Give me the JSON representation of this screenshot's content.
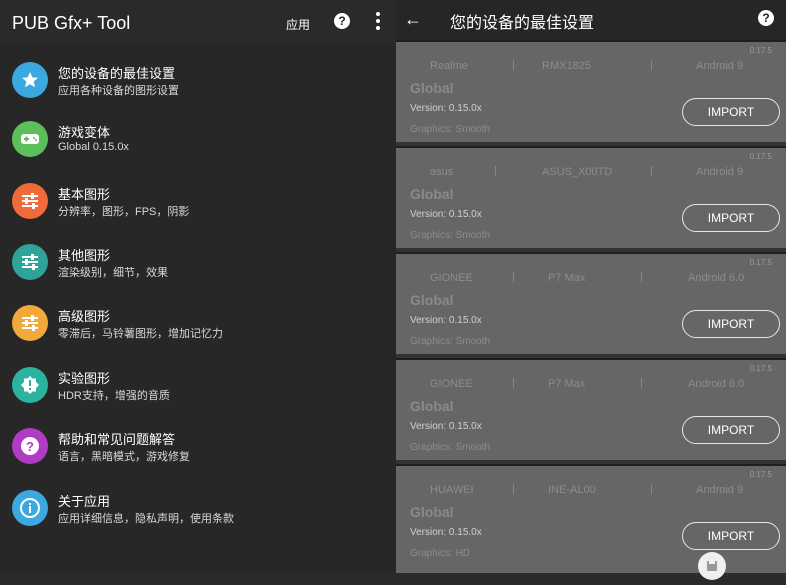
{
  "left": {
    "app_title": "PUB Gfx+ Tool",
    "apply_label": "应用",
    "help_label": "?"
  },
  "menu": [
    {
      "title": "您的设备的最佳设置",
      "subtitle": "应用各种设备的图形设置",
      "icon": "star-icon",
      "color": "#3ba9e0"
    },
    {
      "title": "游戏变体",
      "subtitle": "Global 0.15.0x",
      "icon": "gamepad-icon",
      "color": "#5cbf5c"
    },
    {
      "title": "基本图形",
      "subtitle": "分辨率，图形，FPS，阴影",
      "icon": "sliders-icon",
      "color": "#f06b3a"
    },
    {
      "title": "其他图形",
      "subtitle": "渲染级别，细节，效果",
      "icon": "sliders-icon",
      "color": "#2fa39a"
    },
    {
      "title": "高级图形",
      "subtitle": "零滞后，马铃薯图形，增加记忆力",
      "icon": "sliders-icon",
      "color": "#f2a93b"
    },
    {
      "title": "实验图形",
      "subtitle": "HDR支持，增强的音质",
      "icon": "alert-icon",
      "color": "#2bb3a0"
    },
    {
      "title": "帮助和常见问题解答",
      "subtitle": "语言，黑暗模式，游戏修复",
      "icon": "help-icon",
      "color": "#b03bc4"
    },
    {
      "title": "关于应用",
      "subtitle": "应用详细信息，隐私声明，使用条款",
      "icon": "info-icon",
      "color": "#3ba9e0"
    }
  ],
  "right": {
    "title": "您的设备的最佳设置",
    "back_icon": "arrow-left-icon",
    "help_label": "?"
  },
  "cards": [
    {
      "app_version": "0.17.5",
      "brand": "Realme",
      "model": "RMX1825",
      "android": "Android 9",
      "variant": "Global",
      "version": "Version: 0.15.0x",
      "graphics": "Graphics: Smooth",
      "import_label": "IMPORT"
    },
    {
      "app_version": "0.17.5",
      "brand": "asus",
      "model": "ASUS_X00TD",
      "android": "Android 9",
      "variant": "Global",
      "version": "Version: 0.15.0x",
      "graphics": "Graphics: Smooth",
      "import_label": "IMPORT"
    },
    {
      "app_version": "0.17.5",
      "brand": "GIONEE",
      "model": "P7 Max",
      "android": "Android 6.0",
      "variant": "Global",
      "version": "Version: 0.15.0x",
      "graphics": "Graphics: Smooth",
      "import_label": "IMPORT"
    },
    {
      "app_version": "0.17.5",
      "brand": "GIONEE",
      "model": "P7 Max",
      "android": "Android 6.0",
      "variant": "Global",
      "version": "Version: 0.15.0x",
      "graphics": "Graphics: Smooth",
      "import_label": "IMPORT"
    },
    {
      "app_version": "0.17.5",
      "brand": "HUAWEI",
      "model": "INE-AL00",
      "android": "Android 9",
      "variant": "Global",
      "version": "Version: 0.15.0x",
      "graphics": "Graphics: HD",
      "import_label": "IMPORT"
    }
  ],
  "separator": "|"
}
